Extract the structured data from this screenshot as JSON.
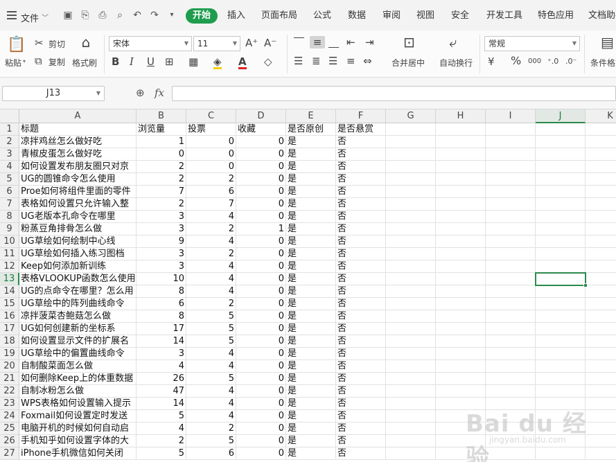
{
  "menubar": {
    "file_label": "文件",
    "tabs": [
      "开始",
      "插入",
      "页面布局",
      "公式",
      "数据",
      "审阅",
      "视图",
      "安全",
      "开发工具",
      "特色应用",
      "文档助手"
    ],
    "active_tab": "开始"
  },
  "ribbon": {
    "paste": "粘贴",
    "cut": "剪切",
    "copy": "复制",
    "format_painter": "格式刷",
    "font_name": "宋体",
    "font_size": "11",
    "bold": "B",
    "italic": "I",
    "underline": "U",
    "merge_center": "合并居中",
    "wrap_text": "自动换行",
    "number_format": "常规",
    "percent": "%",
    "thousands": "000",
    "cond_format": "条件格式"
  },
  "formula_bar": {
    "cell_ref": "J13",
    "fx": "fx",
    "formula": ""
  },
  "columns": [
    "A",
    "B",
    "C",
    "D",
    "E",
    "F",
    "G",
    "H",
    "I",
    "J",
    "K"
  ],
  "selected_column": "J",
  "selected_row": 13,
  "rows": [
    {
      "n": 1,
      "a": "标题",
      "b": "浏览量",
      "c": "投票",
      "d": "收藏",
      "e": "是否原创",
      "f": "是否悬赏"
    },
    {
      "n": 2,
      "a": "凉拌鸡丝怎么做好吃",
      "b": "1",
      "c": "0",
      "d": "0",
      "e": "是",
      "f": "否"
    },
    {
      "n": 3,
      "a": "青椒皮蛋怎么做好吃",
      "b": "0",
      "c": "0",
      "d": "0",
      "e": "是",
      "f": "否"
    },
    {
      "n": 4,
      "a": "如何设置发布朋友圈只对京",
      "b": "2",
      "c": "0",
      "d": "0",
      "e": "是",
      "f": "否"
    },
    {
      "n": 5,
      "a": "UG的圆锥命令怎么使用",
      "b": "2",
      "c": "2",
      "d": "0",
      "e": "是",
      "f": "否"
    },
    {
      "n": 6,
      "a": "Proe如何将组件里面的零件",
      "b": "7",
      "c": "6",
      "d": "0",
      "e": "是",
      "f": "否"
    },
    {
      "n": 7,
      "a": "表格如何设置只允许输入整",
      "b": "2",
      "c": "7",
      "d": "0",
      "e": "是",
      "f": "否"
    },
    {
      "n": 8,
      "a": "UG老版本孔命令在哪里",
      "b": "3",
      "c": "4",
      "d": "0",
      "e": "是",
      "f": "否"
    },
    {
      "n": 9,
      "a": "粉蒸豆角排骨怎么做",
      "b": "3",
      "c": "2",
      "d": "1",
      "e": "是",
      "f": "否"
    },
    {
      "n": 10,
      "a": "UG草绘如何绘制中心线",
      "b": "9",
      "c": "4",
      "d": "0",
      "e": "是",
      "f": "否"
    },
    {
      "n": 11,
      "a": "UG草绘如何插入练习图档",
      "b": "3",
      "c": "2",
      "d": "0",
      "e": "是",
      "f": "否"
    },
    {
      "n": 12,
      "a": "Keep如何添加新训练",
      "b": "3",
      "c": "4",
      "d": "0",
      "e": "是",
      "f": "否"
    },
    {
      "n": 13,
      "a": "表格VLOOKUP函数怎么使用",
      "b": "10",
      "c": "4",
      "d": "0",
      "e": "是",
      "f": "否"
    },
    {
      "n": 14,
      "a": "UG的点命令在哪里？怎么用",
      "b": "8",
      "c": "4",
      "d": "0",
      "e": "是",
      "f": "否"
    },
    {
      "n": 15,
      "a": "UG草绘中的阵列曲线命令",
      "b": "6",
      "c": "2",
      "d": "0",
      "e": "是",
      "f": "否"
    },
    {
      "n": 16,
      "a": "凉拌菠菜杏鲍菇怎么做",
      "b": "8",
      "c": "5",
      "d": "0",
      "e": "是",
      "f": "否"
    },
    {
      "n": 17,
      "a": "UG如何创建新的坐标系",
      "b": "17",
      "c": "5",
      "d": "0",
      "e": "是",
      "f": "否"
    },
    {
      "n": 18,
      "a": "如何设置显示文件的扩展名",
      "b": "14",
      "c": "5",
      "d": "0",
      "e": "是",
      "f": "否"
    },
    {
      "n": 19,
      "a": "UG草绘中的偏置曲线命令",
      "b": "3",
      "c": "4",
      "d": "0",
      "e": "是",
      "f": "否"
    },
    {
      "n": 20,
      "a": "自制酸菜面怎么做",
      "b": "4",
      "c": "4",
      "d": "0",
      "e": "是",
      "f": "否"
    },
    {
      "n": 21,
      "a": "如何删除Keep上的体重数据",
      "b": "26",
      "c": "5",
      "d": "0",
      "e": "是",
      "f": "否"
    },
    {
      "n": 22,
      "a": "自制冰粉怎么做",
      "b": "47",
      "c": "4",
      "d": "0",
      "e": "是",
      "f": "否"
    },
    {
      "n": 23,
      "a": "WPS表格如何设置输入提示",
      "b": "14",
      "c": "4",
      "d": "0",
      "e": "是",
      "f": "否"
    },
    {
      "n": 24,
      "a": "Foxmail如何设置定时发送",
      "b": "5",
      "c": "4",
      "d": "0",
      "e": "是",
      "f": "否"
    },
    {
      "n": 25,
      "a": "电脑开机的时候如何自动启",
      "b": "4",
      "c": "2",
      "d": "0",
      "e": "是",
      "f": "否"
    },
    {
      "n": 26,
      "a": "手机知乎如何设置字体的大",
      "b": "2",
      "c": "5",
      "d": "0",
      "e": "是",
      "f": "否"
    },
    {
      "n": 27,
      "a": "iPhone手机微信如何关闭",
      "b": "5",
      "c": "6",
      "d": "0",
      "e": "是",
      "f": "否"
    }
  ],
  "watermark": {
    "brand": "Bai du 经验",
    "url": "jingyan.baidu.com"
  },
  "colors": {
    "accent": "#1e9d4e",
    "selection": "#2c8a4b"
  }
}
